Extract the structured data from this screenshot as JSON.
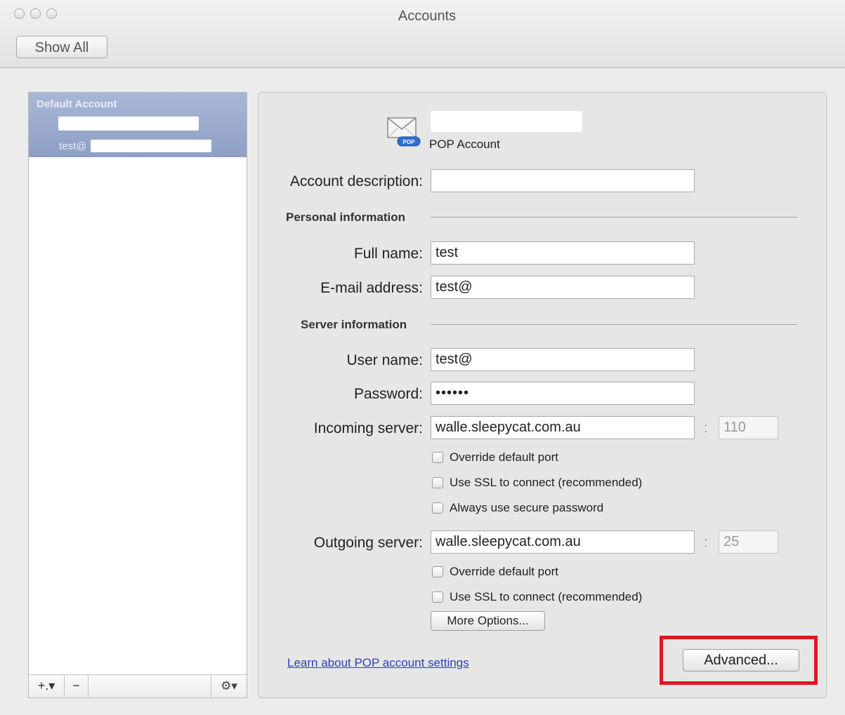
{
  "window": {
    "title": "Accounts"
  },
  "toolbar": {
    "show_all": "Show All"
  },
  "sidebar": {
    "header": "Default Account",
    "email_prefix": "test@",
    "add_label": "+.▾",
    "remove_label": "−",
    "gear_label": "⚙▾"
  },
  "account": {
    "type": "POP Account"
  },
  "form": {
    "description_label": "Account description:",
    "description_value": "",
    "personal_heading": "Personal information",
    "fullname_label": "Full name:",
    "fullname_value": "test",
    "email_label": "E-mail address:",
    "email_value": "test@",
    "server_heading": "Server information",
    "username_label": "User name:",
    "username_value": "test@",
    "password_label": "Password:",
    "password_value": "••••••",
    "incoming_label": "Incoming server:",
    "incoming_value": "walle.sleepycat.com.au",
    "incoming_port": "110",
    "port_sep": ":",
    "in_override": "Override default port",
    "in_ssl": "Use SSL to connect (recommended)",
    "in_secure_pw": "Always use secure password",
    "outgoing_label": "Outgoing server:",
    "outgoing_value": "walle.sleepycat.com.au",
    "outgoing_port": "25",
    "out_override": "Override default port",
    "out_ssl": "Use SSL to connect (recommended)",
    "more_options": "More Options...",
    "learn_link": "Learn about POP account settings",
    "advanced": "Advanced..."
  },
  "colors": {
    "highlight": "#e0161e",
    "link": "#2a3fbf",
    "selection": "#98a8cc"
  }
}
